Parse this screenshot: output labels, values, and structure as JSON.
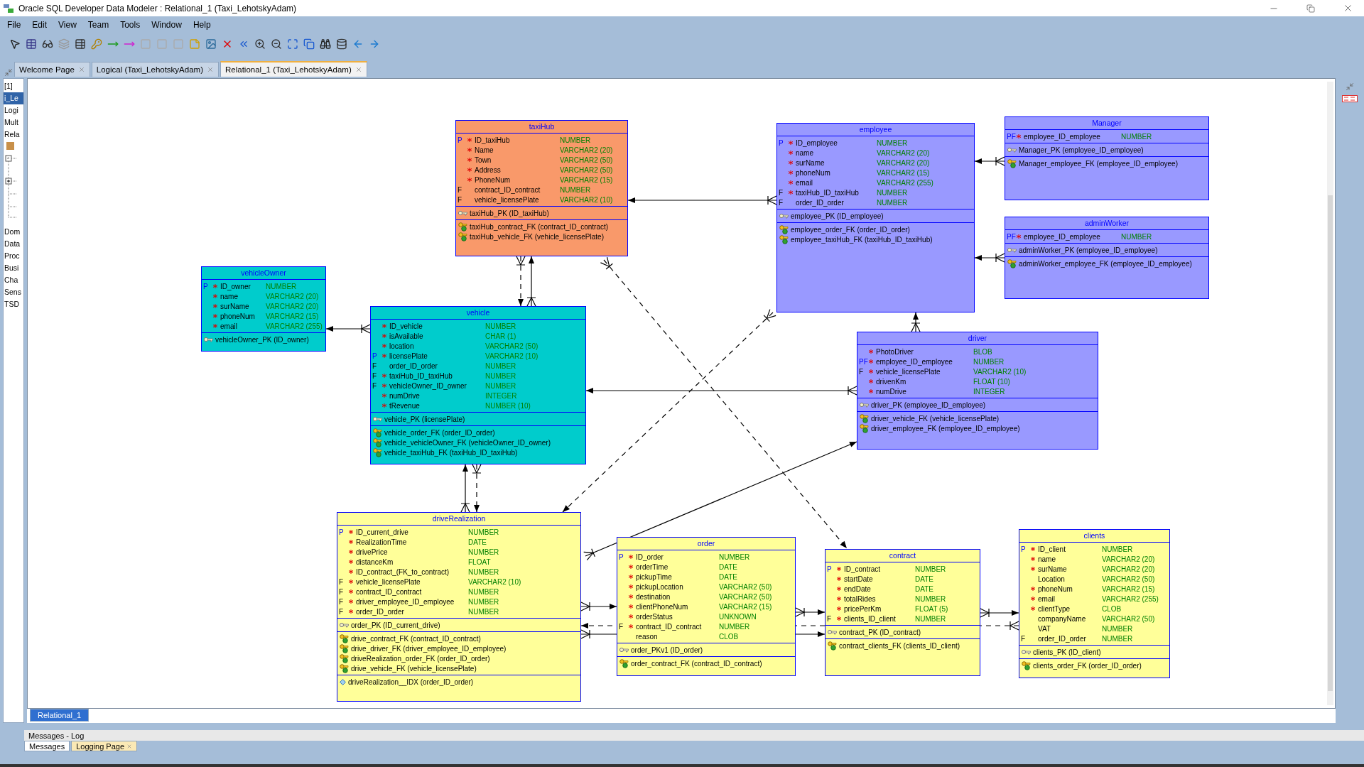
{
  "window": {
    "title": "Oracle SQL Developer Data Modeler : Relational_1 (Taxi_LehotskyAdam)"
  },
  "menu": [
    "File",
    "Edit",
    "View",
    "Team",
    "Tools",
    "Window",
    "Help"
  ],
  "tabs": [
    {
      "label": "Welcome Page",
      "selected": false
    },
    {
      "label": "Logical (Taxi_LehotskyAdam)",
      "selected": false
    },
    {
      "label": "Relational_1 (Taxi_LehotskyAdam)",
      "selected": true
    }
  ],
  "navigator": {
    "items_top": [
      {
        "label": "[1]",
        "selected": false
      },
      {
        "label": "i_Le",
        "selected": true
      },
      {
        "label": "Logi",
        "selected": false
      },
      {
        "label": "Mult",
        "selected": false
      },
      {
        "label": "Rela",
        "selected": false
      }
    ],
    "items_bottom": [
      {
        "label": "Dom",
        "selected": false
      },
      {
        "label": "Data",
        "selected": false
      },
      {
        "label": "Proc",
        "selected": false
      },
      {
        "label": "Busi",
        "selected": false
      },
      {
        "label": "Cha",
        "selected": false
      },
      {
        "label": "Sens",
        "selected": false
      },
      {
        "label": "TSD",
        "selected": false
      }
    ]
  },
  "tables": [
    {
      "name": "taxiHub",
      "color": "#f9996a",
      "columns": [
        {
          "key": "P",
          "primary": true,
          "required": true,
          "name": "ID_taxiHub",
          "type": "NUMBER"
        },
        {
          "required": true,
          "name": "Name",
          "type": "VARCHAR2 (20)"
        },
        {
          "required": true,
          "name": "Town",
          "type": "VARCHAR2 (50)"
        },
        {
          "required": true,
          "name": "Address",
          "type": "VARCHAR2 (50)"
        },
        {
          "required": true,
          "name": "PhoneNum",
          "type": "VARCHAR2 (15)"
        },
        {
          "key": "F",
          "primary": false,
          "required": false,
          "name": "contract_ID_contract",
          "type": "NUMBER"
        },
        {
          "key": "F",
          "primary": false,
          "required": false,
          "name": "vehicle_licensePlate",
          "type": "VARCHAR2 (10)"
        }
      ],
      "primary_keys": [
        "taxiHub_PK (ID_taxiHub)"
      ],
      "foreign_keys": [
        "taxiHub_contract_FK (contract_ID_contract)",
        "taxiHub_vehicle_FK (vehicle_licensePlate)"
      ]
    },
    {
      "name": "employee",
      "color": "#9999ff",
      "columns": [
        {
          "key": "P",
          "primary": true,
          "required": true,
          "name": "ID_employee",
          "type": "NUMBER"
        },
        {
          "required": true,
          "name": "name",
          "type": "VARCHAR2 (20)"
        },
        {
          "required": true,
          "name": "surName",
          "type": "VARCHAR2 (20)"
        },
        {
          "required": true,
          "name": "phoneNum",
          "type": "VARCHAR2 (15)"
        },
        {
          "required": true,
          "name": "email",
          "type": "VARCHAR2 (255)"
        },
        {
          "key": "F",
          "primary": false,
          "required": true,
          "name": "taxiHub_ID_taxiHub",
          "type": "NUMBER"
        },
        {
          "key": "F",
          "primary": false,
          "required": false,
          "name": "order_ID_order",
          "type": "NUMBER"
        }
      ],
      "primary_keys": [
        "employee_PK (ID_employee)"
      ],
      "foreign_keys": [
        "employee_order_FK (order_ID_order)",
        "employee_taxiHub_FK (taxiHub_ID_taxiHub)"
      ]
    },
    {
      "name": "Manager",
      "color": "#9999ff",
      "columns": [
        {
          "key": "PF",
          "primary": true,
          "required": true,
          "name": "employee_ID_employee",
          "type": "NUMBER"
        }
      ],
      "primary_keys": [
        "Manager_PK (employee_ID_employee)"
      ],
      "foreign_keys": [
        "Manager_employee_FK (employee_ID_employee)"
      ]
    },
    {
      "name": "adminWorker",
      "color": "#9999ff",
      "columns": [
        {
          "key": "PF",
          "primary": true,
          "required": true,
          "name": "employee_ID_employee",
          "type": "NUMBER"
        }
      ],
      "primary_keys": [
        "adminWorker_PK (employee_ID_employee)"
      ],
      "foreign_keys": [
        "adminWorker_employee_FK (employee_ID_employee)"
      ]
    },
    {
      "name": "vehicleOwner",
      "color": "#00cccc",
      "columns": [
        {
          "key": "P",
          "primary": true,
          "required": true,
          "name": "ID_owner",
          "type": "NUMBER"
        },
        {
          "required": true,
          "name": "name",
          "type": "VARCHAR2 (20)"
        },
        {
          "required": true,
          "name": "surName",
          "type": "VARCHAR2 (20)"
        },
        {
          "required": true,
          "name": "phoneNum",
          "type": "VARCHAR2 (15)"
        },
        {
          "required": true,
          "name": "email",
          "type": "VARCHAR2 (255)"
        }
      ],
      "primary_keys": [
        "vehicleOwner_PK (ID_owner)"
      ]
    },
    {
      "name": "vehicle",
      "color": "#00cccc",
      "columns": [
        {
          "required": true,
          "name": "ID_vehicle",
          "type": "NUMBER"
        },
        {
          "required": true,
          "name": "isAvailable",
          "type": "CHAR (1)"
        },
        {
          "required": true,
          "name": "location",
          "type": "VARCHAR2 (50)"
        },
        {
          "key": "P",
          "primary": true,
          "required": true,
          "name": "licensePlate",
          "type": "VARCHAR2 (10)"
        },
        {
          "key": "F",
          "primary": false,
          "required": false,
          "name": "order_ID_order",
          "type": "NUMBER"
        },
        {
          "key": "F",
          "primary": false,
          "required": true,
          "name": "taxiHub_ID_taxiHub",
          "type": "NUMBER"
        },
        {
          "key": "F",
          "primary": false,
          "required": true,
          "name": "vehicleOwner_ID_owner",
          "type": "NUMBER"
        },
        {
          "required": true,
          "name": "numDrive",
          "type": "INTEGER"
        },
        {
          "required": true,
          "name": "tRevenue",
          "type": "NUMBER (10)"
        }
      ],
      "primary_keys": [
        "vehicle_PK (licensePlate)"
      ],
      "foreign_keys": [
        "vehicle_order_FK (order_ID_order)",
        "vehicle_vehicleOwner_FK (vehicleOwner_ID_owner)",
        "vehicle_taxiHub_FK (taxiHub_ID_taxiHub)"
      ]
    },
    {
      "name": "driver",
      "color": "#9999ff",
      "columns": [
        {
          "required": true,
          "name": "PhotoDriver",
          "type": "BLOB"
        },
        {
          "key": "PF",
          "primary": true,
          "required": true,
          "name": "employee_ID_employee",
          "type": "NUMBER"
        },
        {
          "key": "F",
          "primary": false,
          "required": true,
          "name": "vehicle_licensePlate",
          "type": "VARCHAR2 (10)"
        },
        {
          "required": true,
          "name": "drivenKm",
          "type": "FLOAT (10)"
        },
        {
          "required": true,
          "name": "numDrive",
          "type": "INTEGER"
        }
      ],
      "primary_keys": [
        "driver_PK (employee_ID_employee)"
      ],
      "foreign_keys": [
        "driver_vehicle_FK (vehicle_licensePlate)",
        "driver_employee_FK (employee_ID_employee)"
      ]
    },
    {
      "name": "driveRealization",
      "color": "#ffff99",
      "columns": [
        {
          "key": "P",
          "primary": true,
          "required": true,
          "name": "ID_current_drive",
          "type": "NUMBER"
        },
        {
          "required": true,
          "name": "RealizationTime",
          "type": "DATE"
        },
        {
          "required": true,
          "name": "drivePrice",
          "type": "NUMBER"
        },
        {
          "required": true,
          "name": "distanceKm",
          "type": "FLOAT"
        },
        {
          "required": true,
          "name": "ID_contract_(FK_to_contract)",
          "type": "NUMBER"
        },
        {
          "key": "F",
          "primary": false,
          "required": true,
          "name": "vehicle_licensePlate",
          "type": "VARCHAR2 (10)"
        },
        {
          "key": "F",
          "primary": false,
          "required": true,
          "name": "contract_ID_contract",
          "type": "NUMBER"
        },
        {
          "key": "F",
          "primary": false,
          "required": true,
          "name": "driver_employee_ID_employee",
          "type": "NUMBER"
        },
        {
          "key": "F",
          "primary": false,
          "required": true,
          "name": "order_ID_order",
          "type": "NUMBER"
        }
      ],
      "primary_keys": [
        "order_PK (ID_current_drive)"
      ],
      "foreign_keys": [
        "drive_contract_FK (contract_ID_contract)",
        "drive_driver_FK (driver_employee_ID_employee)",
        "driveRealization_order_FK (order_ID_order)",
        "drive_vehicle_FK (vehicle_licensePlate)"
      ],
      "indexes": [
        "driveRealization__IDX (order_ID_order)"
      ]
    },
    {
      "name": "order",
      "color": "#ffff99",
      "columns": [
        {
          "key": "P",
          "primary": true,
          "required": true,
          "name": "ID_order",
          "type": "NUMBER"
        },
        {
          "required": true,
          "name": "orderTime",
          "type": "DATE"
        },
        {
          "required": true,
          "name": "pickupTime",
          "type": "DATE"
        },
        {
          "required": true,
          "name": "pickupLocation",
          "type": "VARCHAR2 (50)"
        },
        {
          "required": true,
          "name": "destination",
          "type": "VARCHAR2 (50)"
        },
        {
          "required": true,
          "name": "clientPhoneNum",
          "type": "VARCHAR2 (15)"
        },
        {
          "required": true,
          "name": "orderStatus",
          "type": "UNKNOWN"
        },
        {
          "key": "F",
          "primary": false,
          "required": true,
          "name": "contract_ID_contract",
          "type": "NUMBER"
        },
        {
          "required": false,
          "name": "reason",
          "type": "CLOB"
        }
      ],
      "primary_keys": [
        "order_PKv1 (ID_order)"
      ],
      "foreign_keys": [
        "order_contract_FK (contract_ID_contract)"
      ]
    },
    {
      "name": "contract",
      "color": "#ffff99",
      "columns": [
        {
          "key": "P",
          "primary": true,
          "required": true,
          "name": "ID_contract",
          "type": "NUMBER"
        },
        {
          "required": true,
          "name": "startDate",
          "type": "DATE"
        },
        {
          "required": true,
          "name": "endDate",
          "type": "DATE"
        },
        {
          "required": true,
          "name": "totalRides",
          "type": "NUMBER"
        },
        {
          "required": true,
          "name": "pricePerKm",
          "type": "FLOAT (5)"
        },
        {
          "key": "F",
          "primary": false,
          "required": true,
          "name": "clients_ID_client",
          "type": "NUMBER"
        }
      ],
      "primary_keys": [
        "contract_PK (ID_contract)"
      ],
      "foreign_keys": [
        "contract_clients_FK (clients_ID_client)"
      ]
    },
    {
      "name": "clients",
      "color": "#ffff99",
      "columns": [
        {
          "key": "P",
          "primary": true,
          "required": true,
          "name": "ID_client",
          "type": "NUMBER"
        },
        {
          "required": true,
          "name": "name",
          "type": "VARCHAR2 (20)"
        },
        {
          "required": true,
          "name": "surName",
          "type": "VARCHAR2 (20)"
        },
        {
          "required": false,
          "name": "Location",
          "type": "VARCHAR2 (50)"
        },
        {
          "required": true,
          "name": "phoneNum",
          "type": "VARCHAR2 (15)"
        },
        {
          "required": true,
          "name": "email",
          "type": "VARCHAR2 (255)"
        },
        {
          "required": true,
          "name": "clientType",
          "type": "CLOB"
        },
        {
          "required": false,
          "name": "companyName",
          "type": "VARCHAR2 (50)"
        },
        {
          "required": false,
          "name": "VAT",
          "type": "NUMBER"
        },
        {
          "key": "F",
          "primary": false,
          "required": false,
          "name": "order_ID_order",
          "type": "NUMBER"
        }
      ],
      "primary_keys": [
        "clients_PK (ID_client)"
      ],
      "foreign_keys": [
        "clients_order_FK (order_ID_order)"
      ]
    }
  ],
  "diagram_tabs": [
    {
      "label": "Relational_1",
      "selected": true
    }
  ],
  "log_panel": {
    "title": "Messages - Log",
    "tabs": [
      {
        "label": "Messages",
        "selected": false
      },
      {
        "label": "Logging Page",
        "selected": true
      }
    ]
  }
}
